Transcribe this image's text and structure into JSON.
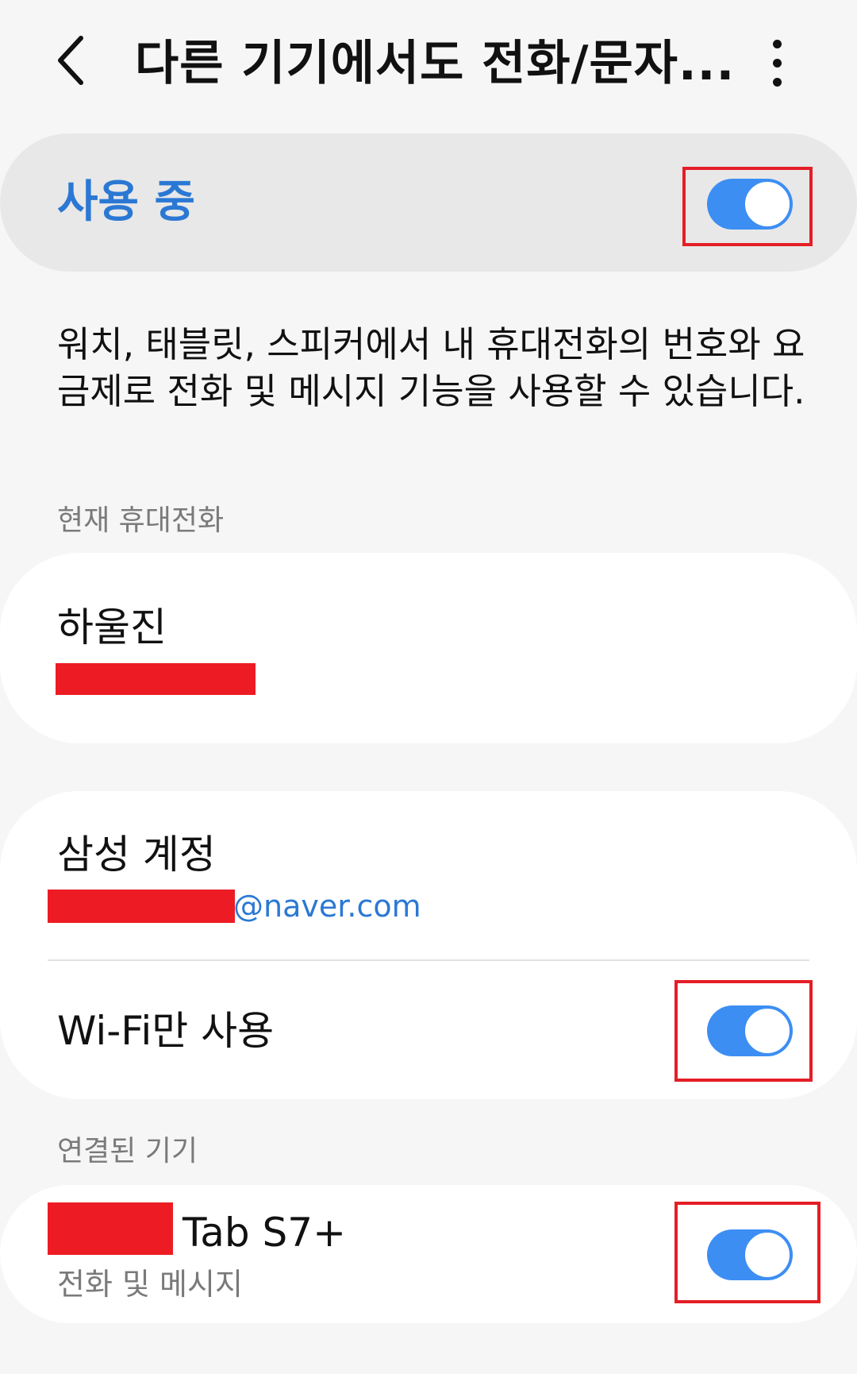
{
  "header": {
    "title": "다른 기기에서도 전화/문자...",
    "back_icon": "chevron-left-icon",
    "more_icon": "more-vertical-icon"
  },
  "master": {
    "label": "사용 중",
    "toggle_on": true
  },
  "description": "워치, 태블릿, 스피커에서 내 휴대전화의 번호와 요금제로 전화 및 메시지 기능을 사용할 수 있습니다.",
  "current_phone": {
    "section_label": "현재 휴대전화",
    "name": "하울진"
  },
  "account": {
    "title": "삼성 계정",
    "email_domain": "@naver.com",
    "wifi_only_label": "Wi-Fi만 사용",
    "wifi_only_on": true
  },
  "connected": {
    "section_label": "연결된 기기",
    "device_name": "Tab S7+",
    "device_sub": "전화 및 메시지",
    "device_on": true
  },
  "colors": {
    "accent": "#2b78d4",
    "toggle": "#3d8ef3",
    "highlight": "#e41e26",
    "redaction": "#ed1c24"
  }
}
